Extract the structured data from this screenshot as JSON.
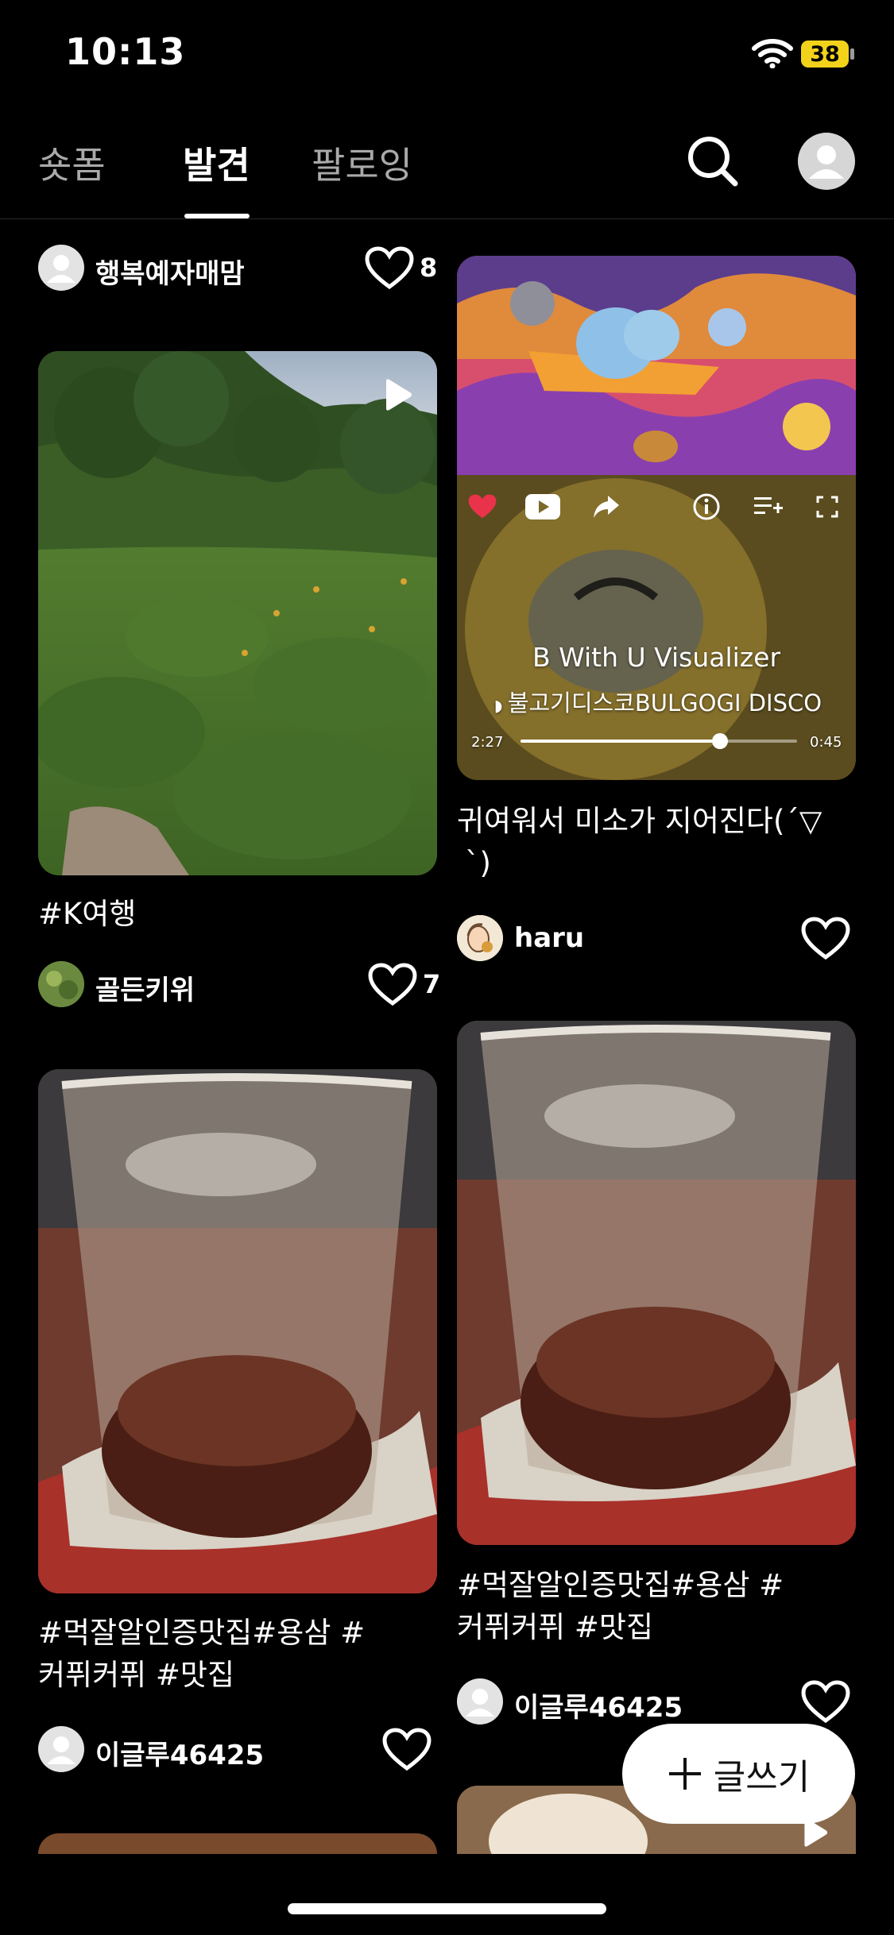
{
  "status_bar": {
    "time": "10:13",
    "battery": "38"
  },
  "tabs": [
    {
      "label": "숏폼"
    },
    {
      "label": "발견"
    },
    {
      "label": "팔로잉"
    }
  ],
  "feed": {
    "left": [
      {
        "user": "행복예자매맘",
        "likes": "8"
      },
      {
        "caption": "#K여행",
        "user": "골든키위",
        "likes": "7"
      },
      {
        "caption_line1": "#먹잘알인증맛집#용삼 #",
        "caption_line2": "커퓌커퓌 #맛집",
        "user": "이글루46425"
      }
    ],
    "right": [
      {
        "player_title": "B With U Visualizer",
        "player_channel": "불고기디스코BULGOGI DISCO",
        "time_elapsed": "2:27",
        "time_remaining": "0:45",
        "progress": 0.72,
        "caption_line1": "귀여워서 미소가 지어진다(´▽",
        "caption_line2": "`)",
        "user": "haru"
      },
      {
        "caption_line1": "#먹잘알인증맛집#용삼 #",
        "caption_line2": "커퓌커퓌 #맛집",
        "user": "이글루46425"
      }
    ]
  },
  "fab": {
    "label": "글쓰기"
  },
  "colors": {
    "background": "#000000",
    "battery": "#f2d21b",
    "heart_red": "#e8334a"
  }
}
